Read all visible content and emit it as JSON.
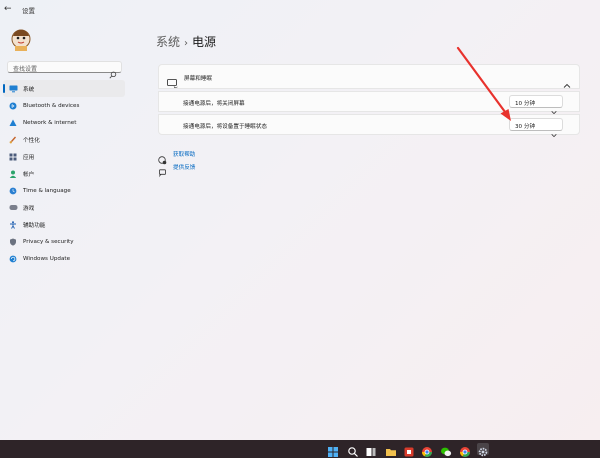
{
  "window": {
    "title": "设置"
  },
  "search": {
    "placeholder": "查找设置"
  },
  "sidebar": {
    "items": [
      {
        "label": "系统",
        "icon": "monitor-icon",
        "selected": true
      },
      {
        "label": "Bluetooth & devices",
        "icon": "bluetooth-icon"
      },
      {
        "label": "Network & internet",
        "icon": "network-icon"
      },
      {
        "label": "个性化",
        "icon": "brush-icon"
      },
      {
        "label": "应用",
        "icon": "apps-icon"
      },
      {
        "label": "帐户",
        "icon": "account-icon"
      },
      {
        "label": "Time & language",
        "icon": "clock-language-icon"
      },
      {
        "label": "游戏",
        "icon": "gaming-icon"
      },
      {
        "label": "辅助功能",
        "icon": "accessibility-icon"
      },
      {
        "label": "Privacy & security",
        "icon": "shield-icon"
      },
      {
        "label": "Windows Update",
        "icon": "update-icon"
      }
    ]
  },
  "breadcrumb": {
    "parent": "系统",
    "separator": "›",
    "current": "电源"
  },
  "power": {
    "section_title": "屏幕和睡眠",
    "screen_off_label": "接通电源后，将关闭屏幕",
    "screen_off_value": "10 分钟",
    "sleep_label": "接通电源后，将设备置于睡眠状态",
    "sleep_value": "30 分钟"
  },
  "links": {
    "help": "获取帮助",
    "feedback": "提供反馈"
  },
  "colors": {
    "accent": "#0067c0",
    "annotation_arrow": "#e8322d",
    "taskbar": "#2e2428"
  },
  "taskbar_icons": [
    "windows-start-icon",
    "search-icon",
    "task-view-icon",
    "file-explorer-icon",
    "office-icon",
    "chrome-icon",
    "wechat-icon",
    "chrome-alt-icon",
    "settings-gear-icon"
  ]
}
